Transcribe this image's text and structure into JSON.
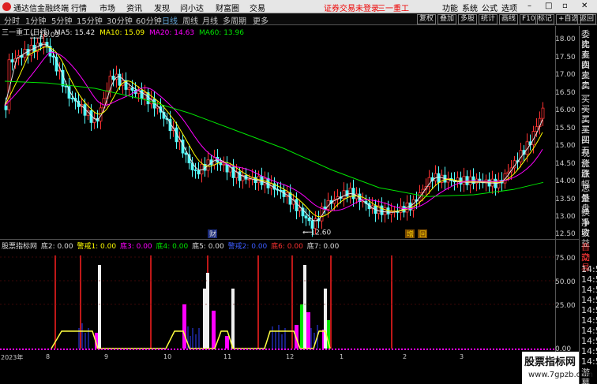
{
  "menubar": {
    "app_name": "通达信金融终端",
    "items": [
      "行情",
      "市场",
      "资讯",
      "发现",
      "问小达",
      "财富圈",
      "交易"
    ],
    "warning": "证券交易未登录",
    "stock": "三一重工",
    "right_items": [
      "功能",
      "系统",
      "公式",
      "选项"
    ]
  },
  "period_tabs": [
    "分时",
    "1分钟",
    "5分钟",
    "15分钟",
    "30分钟",
    "60分钟",
    "日线",
    "周线",
    "月线",
    "多周期",
    "更多"
  ],
  "active_period": "日线",
  "toolbar": [
    "复权",
    "叠加",
    "多股",
    "统计",
    "画线",
    "F10",
    "标记",
    "+自选",
    "返回"
  ],
  "main_legend": {
    "stock": "三一重工(日线)",
    "ma5": "MA5: 15.42",
    "ma10": "MA10: 15.09",
    "ma20": "MA20: 14.63",
    "ma60": "MA60: 13.96"
  },
  "price_annotations": {
    "high": "18.03",
    "low": "12.60",
    "cai_label": "财",
    "zeng_label": "增",
    "hui_label": "回"
  },
  "price_axis": [
    "18.00",
    "17.50",
    "17.00",
    "16.50",
    "16.00",
    "15.50",
    "15.00",
    "14.50",
    "14.00",
    "13.50",
    "13.00",
    "12.50"
  ],
  "sub_legend": {
    "name": "股票指标网",
    "items": [
      "底2: 0.00",
      "警戒1: 0.00",
      "底3: 0.00",
      "底4: 0.00",
      "底5: 0.00",
      "警戒2: 0.00",
      "底6: 0.00",
      "底7: 0.00"
    ]
  },
  "sub_axis": [
    "75.00",
    "50.00",
    "25.00",
    "0.00"
  ],
  "right_panel": {
    "top": [
      "委比",
      "卖五",
      "卖四",
      "卖三",
      "卖二",
      "卖一",
      "买一",
      "买二",
      "买三",
      "买四",
      "买五",
      "现价",
      "涨跌",
      "涨幅",
      "总量",
      "外盘",
      "换手",
      "净资",
      "收益"
    ],
    "bottom": [
      "自动",
      "交易",
      "14:5",
      "14:5",
      "14:5",
      "14:5",
      "14:5",
      "14:5",
      "14:5",
      "14:5",
      "14:5",
      "14:5",
      "游幕"
    ]
  },
  "timeline": [
    "2023年",
    "8",
    "9",
    "10",
    "11",
    "12",
    "1",
    "2",
    "3"
  ],
  "watermark": {
    "title": "股票指标网",
    "url": "www.7gpzb.com"
  },
  "colors": {
    "up": "#ff3232",
    "down": "#54ffff",
    "ma5": "#e6e6e6",
    "ma10": "#ffff00",
    "ma20": "#ff00ff",
    "ma60": "#00e600"
  }
}
